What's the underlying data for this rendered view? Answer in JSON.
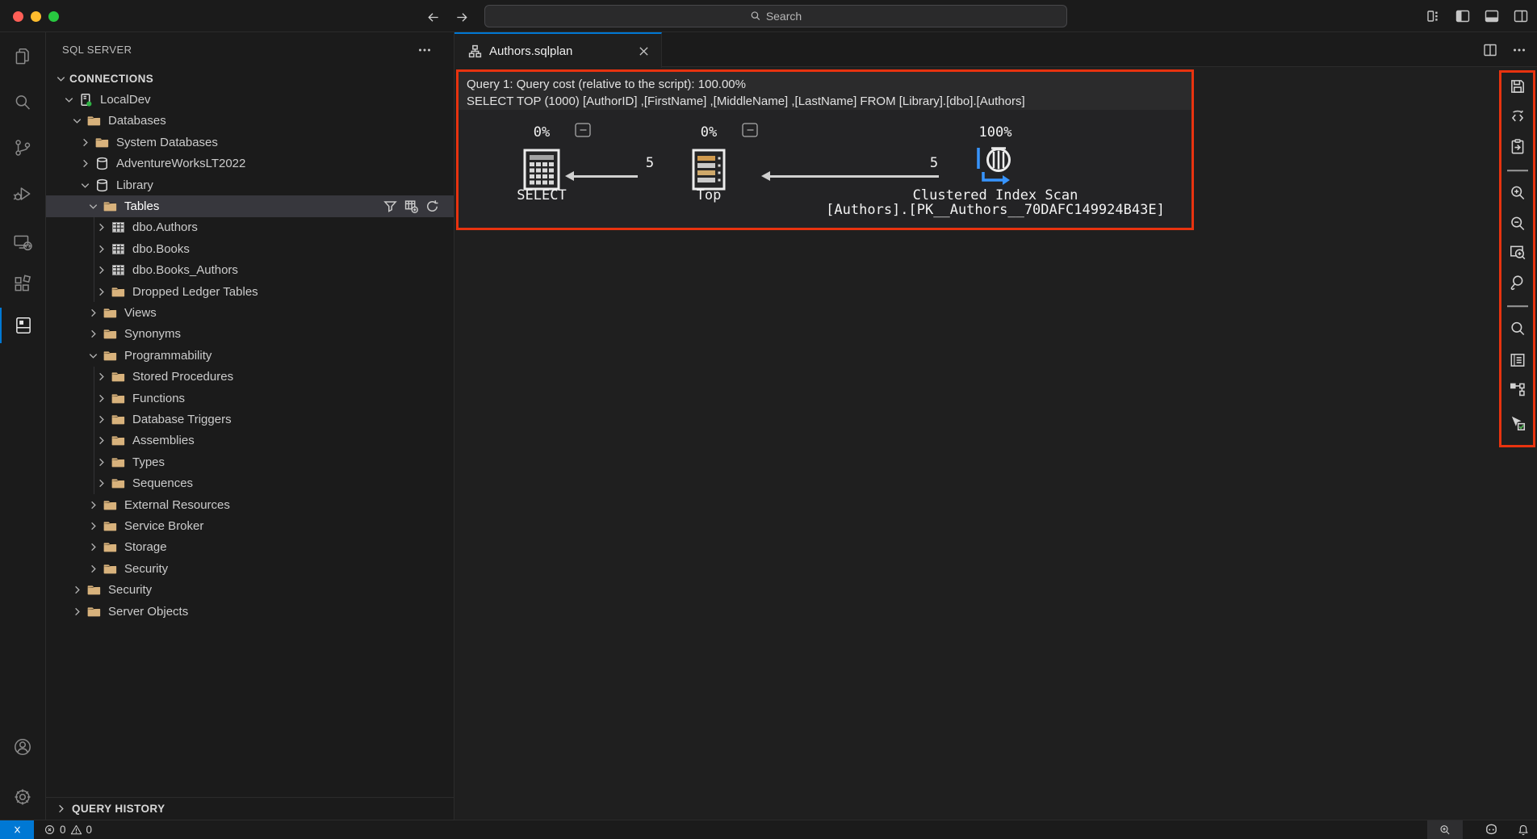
{
  "colors": {
    "accent": "#0078d4",
    "annotation": "#e8330f",
    "folder": "#d8b27c",
    "connected": "#2fb344"
  },
  "titlebar": {
    "search_placeholder": "Search",
    "window_controls": [
      "close",
      "minimize",
      "zoom"
    ],
    "nav_icons": [
      "arrow-left",
      "arrow-right"
    ],
    "copilot_icon": "copilot",
    "right_icons": [
      "layout",
      "panel-left",
      "panel-bottom",
      "panel-right"
    ]
  },
  "activity_bar": {
    "top": [
      "explorer",
      "search",
      "source-control",
      "run-debug",
      "remote-explorer",
      "extensions",
      "sql-server"
    ],
    "active": "sql-server",
    "bottom": [
      "accounts",
      "settings"
    ]
  },
  "sidebar": {
    "title": "SQL SERVER",
    "more_icon": "more",
    "query_history_label": "QUERY HISTORY",
    "tree": [
      {
        "label": "CONNECTIONS",
        "level": 0,
        "chevron": "down",
        "icon": null,
        "bold": true
      },
      {
        "label": "LocalDev",
        "level": 1,
        "chevron": "down",
        "icon": "server"
      },
      {
        "label": "Databases",
        "level": 2,
        "chevron": "down",
        "icon": "folder"
      },
      {
        "label": "System Databases",
        "level": 3,
        "chevron": "right",
        "icon": "folder"
      },
      {
        "label": "AdventureWorksLT2022",
        "level": 3,
        "chevron": "right",
        "icon": "database"
      },
      {
        "label": "Library",
        "level": 3,
        "chevron": "down",
        "icon": "database"
      },
      {
        "label": "Tables",
        "level": 4,
        "chevron": "down",
        "icon": "folder",
        "selected": true,
        "actions": [
          "filter",
          "new-table",
          "refresh"
        ]
      },
      {
        "label": "dbo.Authors",
        "level": 5,
        "chevron": "right",
        "icon": "table"
      },
      {
        "label": "dbo.Books",
        "level": 5,
        "chevron": "right",
        "icon": "table"
      },
      {
        "label": "dbo.Books_Authors",
        "level": 5,
        "chevron": "right",
        "icon": "table"
      },
      {
        "label": "Dropped Ledger Tables",
        "level": 5,
        "chevron": "right",
        "icon": "folder"
      },
      {
        "label": "Views",
        "level": 4,
        "chevron": "right",
        "icon": "folder"
      },
      {
        "label": "Synonyms",
        "level": 4,
        "chevron": "right",
        "icon": "folder"
      },
      {
        "label": "Programmability",
        "level": 4,
        "chevron": "down",
        "icon": "folder"
      },
      {
        "label": "Stored Procedures",
        "level": 5,
        "chevron": "right",
        "icon": "folder"
      },
      {
        "label": "Functions",
        "level": 5,
        "chevron": "right",
        "icon": "folder"
      },
      {
        "label": "Database Triggers",
        "level": 5,
        "chevron": "right",
        "icon": "folder"
      },
      {
        "label": "Assemblies",
        "level": 5,
        "chevron": "right",
        "icon": "folder"
      },
      {
        "label": "Types",
        "level": 5,
        "chevron": "right",
        "icon": "folder"
      },
      {
        "label": "Sequences",
        "level": 5,
        "chevron": "right",
        "icon": "folder"
      },
      {
        "label": "External Resources",
        "level": 4,
        "chevron": "right",
        "icon": "folder"
      },
      {
        "label": "Service Broker",
        "level": 4,
        "chevron": "right",
        "icon": "folder"
      },
      {
        "label": "Storage",
        "level": 4,
        "chevron": "right",
        "icon": "folder"
      },
      {
        "label": "Security",
        "level": 4,
        "chevron": "right",
        "icon": "folder"
      },
      {
        "label": "Security",
        "level": 2,
        "chevron": "right",
        "icon": "folder"
      },
      {
        "label": "Server Objects",
        "level": 2,
        "chevron": "right",
        "icon": "folder"
      }
    ]
  },
  "editor": {
    "tab": {
      "label": "Authors.sqlplan",
      "icon": "plan"
    }
  },
  "plan": {
    "header_line1": "Query 1: Query cost (relative to the script): 100.00%",
    "header_line2": "SELECT TOP (1000) [AuthorID] ,[FirstName] ,[MiddleName] ,[LastName] FROM [Library].[dbo].[Authors]",
    "nodes": [
      {
        "name": "SELECT",
        "percent": "0%",
        "icon": "node-select"
      },
      {
        "name": "Top",
        "percent": "0%",
        "icon": "node-top"
      },
      {
        "name": "Clustered Index Scan",
        "subtitle": "[Authors].[PK__Authors__70DAFC149924B43E]",
        "percent": "100%",
        "icon": "node-cis"
      }
    ],
    "edges": [
      {
        "label": "5"
      },
      {
        "label": "5"
      }
    ]
  },
  "plan_toolbar": [
    "save-plan",
    "open-xml",
    "open-query",
    "separator",
    "zoom-in",
    "zoom-out",
    "zoom-to-fit",
    "custom-zoom",
    "separator",
    "find-node",
    "properties",
    "highlight-ops",
    "toggle-tooltip"
  ],
  "status_bar": {
    "errors": "0",
    "warnings": "0",
    "right_icons": [
      "status-zoom",
      "copilot",
      "bell"
    ]
  }
}
